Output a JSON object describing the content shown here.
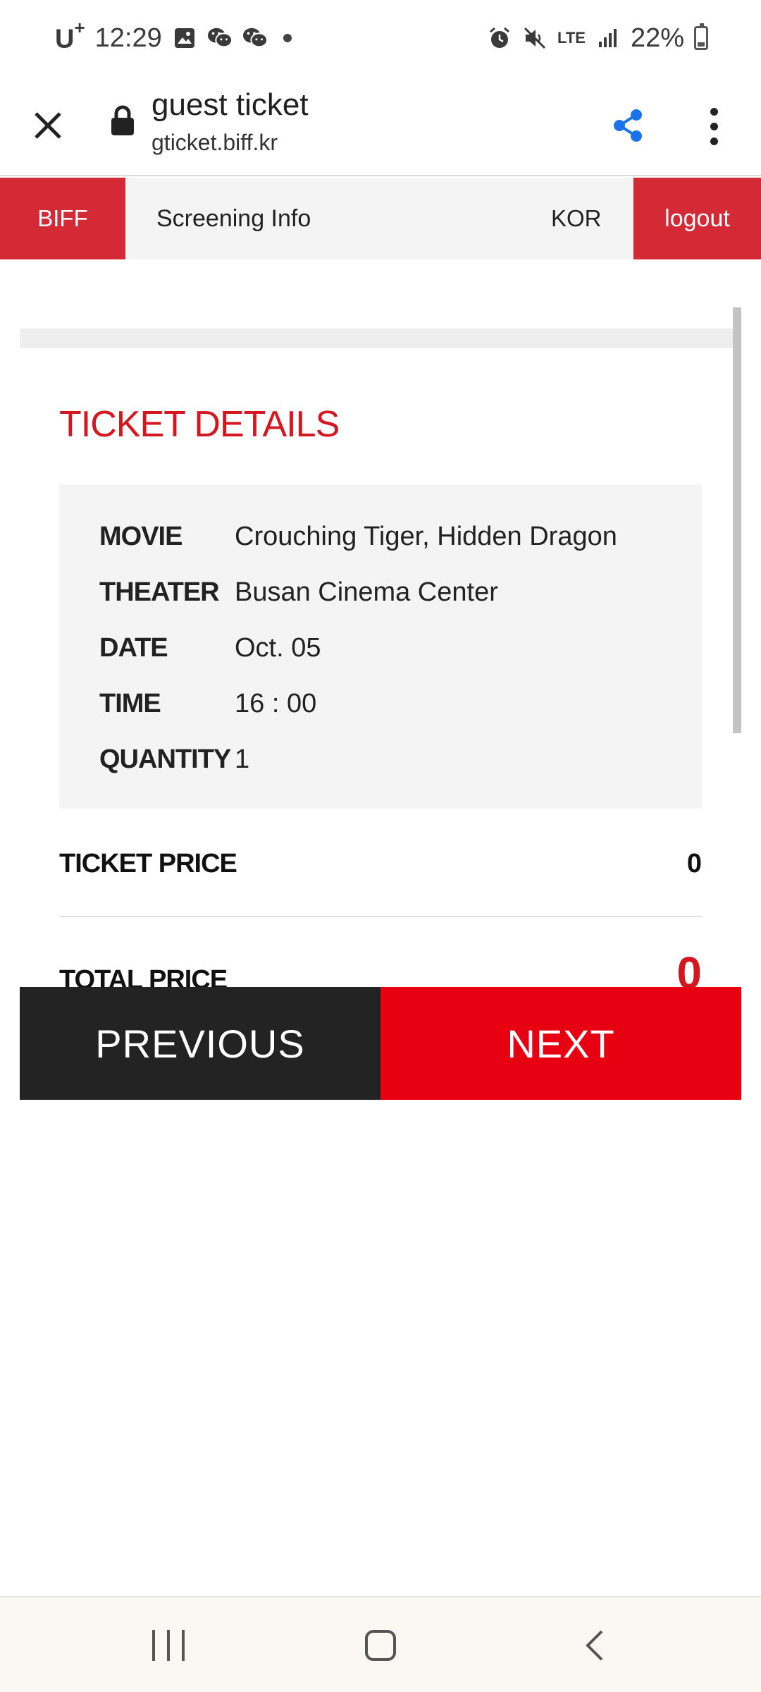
{
  "status_bar": {
    "carrier": "U",
    "carrier_sup": "+",
    "time": "12:29",
    "network": "LTE",
    "battery": "22%"
  },
  "browser": {
    "page_title": "guest ticket",
    "host": "gticket.biff.kr",
    "icons": [
      "close-icon",
      "lock-icon",
      "share-icon",
      "more-vert-icon"
    ],
    "accent_color": "#1a73e8"
  },
  "site_nav": {
    "brand": "BIFF",
    "screening": "Screening Info",
    "language": "KOR",
    "logout": "logout",
    "brand_color": "#d42a36"
  },
  "ticket": {
    "title": "TICKET DETAILS",
    "rows": [
      {
        "label": "MOVIE",
        "value": "Crouching Tiger, Hidden Dragon"
      },
      {
        "label": "THEATER",
        "value": "Busan Cinema Center"
      },
      {
        "label": "DATE",
        "value": "Oct. 05"
      },
      {
        "label": "TIME",
        "value": "16 : 00"
      },
      {
        "label": "QUANTITY",
        "value": "1"
      }
    ],
    "ticket_price_label": "TICKET PRICE",
    "ticket_price_value": "0",
    "total_price_label": "TOTAL PRICE",
    "total_price_value": "0"
  },
  "actions": {
    "previous": "PREVIOUS",
    "next": "NEXT",
    "next_color": "#e60012",
    "previous_color": "#232323"
  }
}
